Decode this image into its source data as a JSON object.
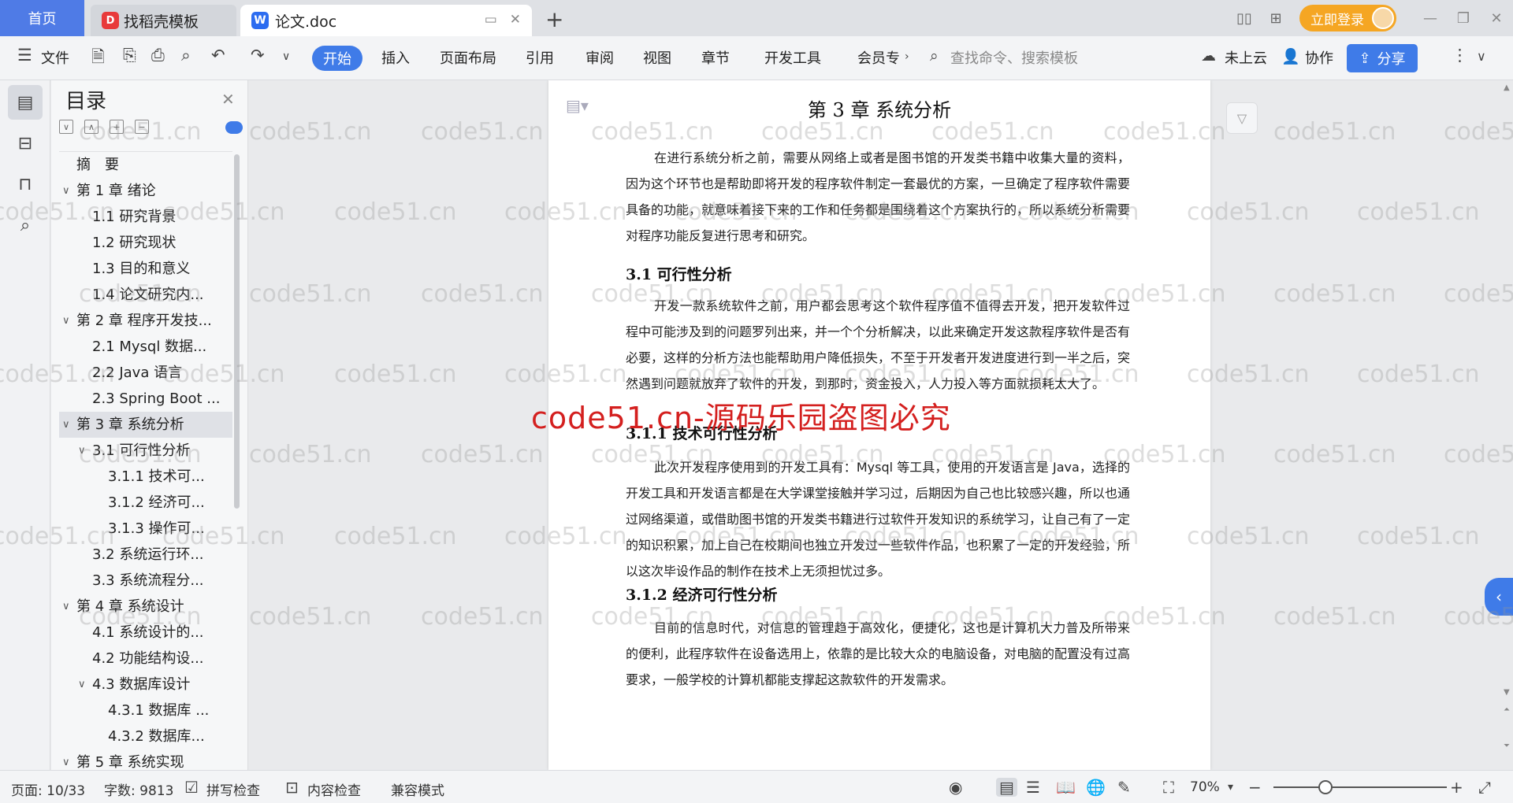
{
  "titlebar": {
    "home_tab": "首页",
    "tabs": [
      {
        "label": "找稻壳模板"
      },
      {
        "label": "论文.doc"
      }
    ],
    "new_tab": "+",
    "login_label": "立即登录"
  },
  "ribbon": {
    "file_label": "文件",
    "tabs": [
      "开始",
      "插入",
      "页面布局",
      "引用",
      "审阅",
      "视图",
      "章节",
      "开发工具",
      "会员专"
    ],
    "search_placeholder": "查找命令、搜索模板",
    "cloud_label": "未上云",
    "collab_label": "协作",
    "share_label": "分享"
  },
  "toc": {
    "title": "目录",
    "items": [
      {
        "label": "摘　要",
        "level": 0,
        "chev": ""
      },
      {
        "label": "第 1 章  绪论",
        "level": 0,
        "chev": "∨"
      },
      {
        "label": "1.1  研究背景",
        "level": 1,
        "chev": ""
      },
      {
        "label": "1.2  研究现状",
        "level": 1,
        "chev": ""
      },
      {
        "label": "1.3  目的和意义",
        "level": 1,
        "chev": ""
      },
      {
        "label": "1.4  论文研究内...",
        "level": 1,
        "chev": ""
      },
      {
        "label": "第 2 章  程序开发技...",
        "level": 0,
        "chev": "∨"
      },
      {
        "label": "2.1 Mysql 数据...",
        "level": 1,
        "chev": ""
      },
      {
        "label": "2.2 Java 语言",
        "level": 1,
        "chev": ""
      },
      {
        "label": "2.3 Spring Boot ...",
        "level": 1,
        "chev": ""
      },
      {
        "label": "第 3 章  系统分析",
        "level": 0,
        "chev": "∨",
        "selected": true
      },
      {
        "label": "3.1 可行性分析",
        "level": 1,
        "chev": "∨"
      },
      {
        "label": "3.1.1 技术可...",
        "level": 2,
        "chev": ""
      },
      {
        "label": "3.1.2 经济可...",
        "level": 2,
        "chev": ""
      },
      {
        "label": "3.1.3 操作可...",
        "level": 2,
        "chev": ""
      },
      {
        "label": "3.2 系统运行环...",
        "level": 1,
        "chev": ""
      },
      {
        "label": "3.3 系统流程分...",
        "level": 1,
        "chev": ""
      },
      {
        "label": "第 4 章  系统设计",
        "level": 0,
        "chev": "∨"
      },
      {
        "label": "4.1  系统设计的...",
        "level": 1,
        "chev": ""
      },
      {
        "label": "4.2  功能结构设...",
        "level": 1,
        "chev": ""
      },
      {
        "label": "4.3  数据库设计",
        "level": 1,
        "chev": "∨"
      },
      {
        "label": "4.3.1  数据库 ...",
        "level": 2,
        "chev": ""
      },
      {
        "label": "4.3.2  数据库...",
        "level": 2,
        "chev": ""
      },
      {
        "label": "第 5 章  系统实现",
        "level": 0,
        "chev": "∨"
      }
    ]
  },
  "document": {
    "heading": "第 3 章  系统分析",
    "intro": "在进行系统分析之前，需要从网络上或者是图书馆的开发类书籍中收集大量的资料，因为这个环节也是帮助即将开发的程序软件制定一套最优的方案，一旦确定了程序软件需要具备的功能，就意味着接下来的工作和任务都是围绕着这个方案执行的，所以系统分析需要对程序功能反复进行思考和研究。",
    "h_31": "3.1 可行性分析",
    "p_31": "开发一款系统软件之前，用户都会思考这个软件程序值不值得去开发，把开发软件过程中可能涉及到的问题罗列出来，并一个个分析解决，以此来确定开发这款程序软件是否有必要，这样的分析方法也能帮助用户降低损失，不至于开发者开发进度进行到一半之后，突然遇到问题就放弃了软件的开发，到那时，资金投入，人力投入等方面就损耗太大了。",
    "h_311": "3.1.1 技术可行性分析",
    "p_311": "此次开发程序使用到的开发工具有：Mysql 等工具，使用的开发语言是 Java，选择的开发工具和开发语言都是在大学课堂接触并学习过，后期因为自己也比较感兴趣，所以也通过网络渠道，或借助图书馆的开发类书籍进行过软件开发知识的系统学习，让自己有了一定的知识积累，加上自己在校期间也独立开发过一些软件作品，也积累了一定的开发经验，所以这次毕设作品的制作在技术上无须担忧过多。",
    "h_312": "3.1.2 经济可行性分析",
    "p_312": "目前的信息时代，对信息的管理趋于高效化，便捷化，这也是计算机大力普及所带来的便利，此程序软件在设备选用上，依靠的是比较大众的电脑设备，对电脑的配置没有过高要求，一般学校的计算机都能支撑起这款软件的开发需求。"
  },
  "watermark": {
    "text": "code51.cn",
    "red_text": "code51.cn-源码乐园盗图必究"
  },
  "statusbar": {
    "page": "页面: 10/33",
    "words": "字数: 9813",
    "spell": "拼写检查",
    "content_check": "内容检查",
    "compat": "兼容模式",
    "zoom": "70%"
  }
}
